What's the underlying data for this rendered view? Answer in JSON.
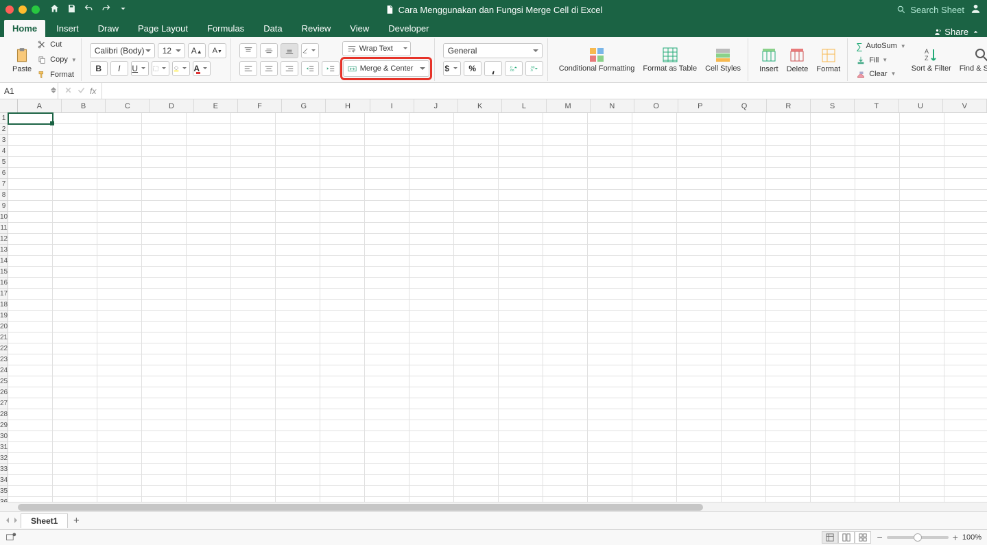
{
  "titlebar": {
    "doc_title": "Cara Menggunakan dan Fungsi Merge Cell di Excel",
    "search_placeholder": "Search Sheet"
  },
  "tabs": {
    "items": [
      "Home",
      "Insert",
      "Draw",
      "Page Layout",
      "Formulas",
      "Data",
      "Review",
      "View",
      "Developer"
    ],
    "active": "Home",
    "share_label": "Share"
  },
  "ribbon": {
    "paste": "Paste",
    "cut": "Cut",
    "copy": "Copy",
    "format": "Format",
    "font_name": "Calibri (Body)",
    "font_size": "12",
    "wrap_text": "Wrap Text",
    "merge_center": "Merge & Center",
    "number_format": "General",
    "cond_format": "Conditional Formatting",
    "format_table": "Format as Table",
    "cell_styles": "Cell Styles",
    "insert": "Insert",
    "delete": "Delete",
    "format_cells": "Format",
    "autosum": "AutoSum",
    "fill": "Fill",
    "clear": "Clear",
    "sort_filter": "Sort & Filter",
    "find_select": "Find & Select"
  },
  "namebox": {
    "ref": "A1"
  },
  "columns": [
    "A",
    "B",
    "C",
    "D",
    "E",
    "F",
    "G",
    "H",
    "I",
    "J",
    "K",
    "L",
    "M",
    "N",
    "O",
    "P",
    "Q",
    "R",
    "S",
    "T",
    "U",
    "V"
  ],
  "row_count": 36,
  "sheets": {
    "active": "Sheet1"
  },
  "status": {
    "zoom": "100%"
  }
}
